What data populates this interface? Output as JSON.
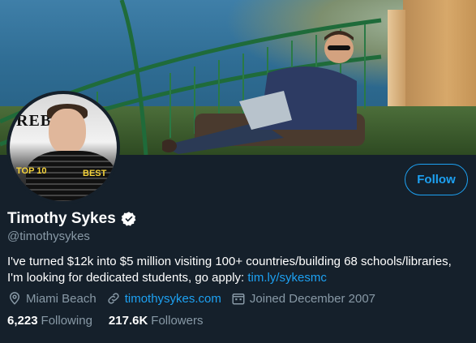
{
  "profile": {
    "display_name": "Timothy Sykes",
    "handle": "@timothysykes",
    "bio_text": "I've turned $12k into $5 million visiting 100+ countries/building 68 schools/libraries, I'm looking for dedicated students, go apply: ",
    "bio_link": "tim.ly/sykesmc",
    "location": "Miami Beach",
    "website": "timothysykes.com",
    "joined": "Joined December 2007",
    "verified_icon": "verified-badge-icon"
  },
  "actions": {
    "follow_label": "Follow"
  },
  "stats": {
    "following_count": "6,223",
    "following_label": "Following",
    "followers_count": "217.6K",
    "followers_label": "Followers"
  },
  "avatar_art": {
    "masthead": "REBEL",
    "badge_left": "TOP 10",
    "badge_right": "BEST"
  },
  "colors": {
    "background": "#15202b",
    "accent": "#1da1f2",
    "secondary_text": "#8899a6",
    "primary_text": "#ffffff"
  }
}
